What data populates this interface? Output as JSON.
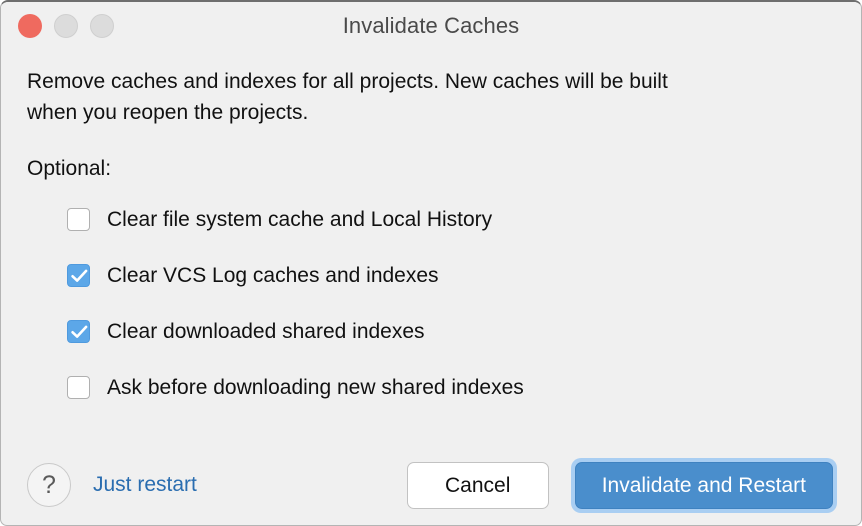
{
  "window": {
    "title": "Invalidate Caches",
    "traffic_lights": [
      {
        "name": "close",
        "color": "#ef6a5f"
      },
      {
        "name": "minimize",
        "color": "#dcdcdc"
      },
      {
        "name": "maximize",
        "color": "#dcdcdc"
      }
    ]
  },
  "body": {
    "description": "Remove caches and indexes for all projects. New caches will be built when you reopen the projects.",
    "optional_label": "Optional:",
    "options": [
      {
        "label": "Clear file system cache and Local History",
        "checked": false
      },
      {
        "label": "Clear VCS Log caches and indexes",
        "checked": true
      },
      {
        "label": "Clear downloaded shared indexes",
        "checked": true
      },
      {
        "label": "Ask before downloading new shared indexes",
        "checked": false
      }
    ]
  },
  "footer": {
    "help_glyph": "?",
    "just_restart_label": "Just restart",
    "cancel_label": "Cancel",
    "confirm_label": "Invalidate and Restart"
  },
  "colors": {
    "accent_blue": "#4a8ecc",
    "checkbox_blue": "#5ca7e8",
    "link_blue": "#2a6db0",
    "focus_ring": "#a9cef2",
    "background": "#f0f0f0"
  }
}
